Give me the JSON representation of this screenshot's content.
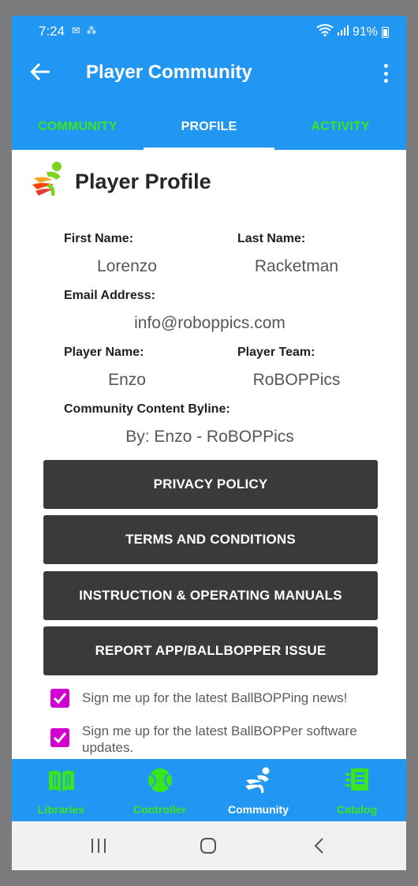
{
  "status_bar": {
    "time": "7:24",
    "battery": "91%"
  },
  "app_bar": {
    "title": "Player Community"
  },
  "tabs": [
    {
      "label": "COMMUNITY",
      "active": false
    },
    {
      "label": "PROFILE",
      "active": true
    },
    {
      "label": "ACTIVITY",
      "active": false
    }
  ],
  "profile": {
    "heading": "Player Profile",
    "first_name_label": "First Name:",
    "first_name": "Lorenzo",
    "last_name_label": "Last Name:",
    "last_name": "Racketman",
    "email_label": "Email Address:",
    "email": "info@roboppics.com",
    "player_name_label": "Player Name:",
    "player_name": "Enzo",
    "player_team_label": "Player Team:",
    "player_team": "RoBOPPics",
    "byline_label": "Community Content Byline:",
    "byline": "By: Enzo - RoBOPPics"
  },
  "buttons": {
    "privacy": "PRIVACY POLICY",
    "terms": "TERMS AND CONDITIONS",
    "manuals": "INSTRUCTION & OPERATING MANUALS",
    "report": "REPORT APP/BALLBOPPER ISSUE"
  },
  "checkboxes": [
    {
      "label": "Sign me up for the latest BallBOPPing news!",
      "checked": true
    },
    {
      "label": "Sign me up for the latest BallBOPPer software updates.",
      "checked": true
    }
  ],
  "bottom_nav": [
    {
      "label": "Libraries",
      "icon": "book-icon",
      "active": false
    },
    {
      "label": "Controller",
      "icon": "tennis-ball-icon",
      "active": false
    },
    {
      "label": "Community",
      "icon": "player-icon",
      "active": true
    },
    {
      "label": "Catalog",
      "icon": "catalog-icon",
      "active": false
    }
  ],
  "colors": {
    "primary": "#2196f3",
    "accent_green": "#39e61e",
    "checkbox": "#d100d1",
    "button": "#3a3a3c"
  }
}
